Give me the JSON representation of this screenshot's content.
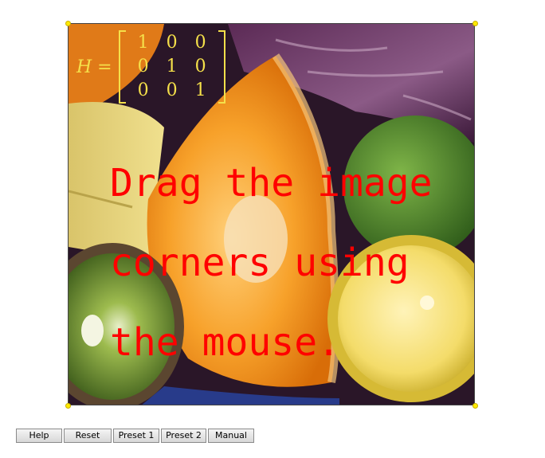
{
  "matrix": {
    "lhs": "H =",
    "rows": [
      [
        "1",
        "0",
        "0"
      ],
      [
        "0",
        "1",
        "0"
      ],
      [
        "0",
        "0",
        "1"
      ]
    ],
    "color": "#f5e04a"
  },
  "instructions": {
    "lines": [
      "Drag the image",
      "corners using",
      "the mouse."
    ],
    "color": "#ff0000"
  },
  "handle_color": "#ffea00",
  "buttons": {
    "help": "Help",
    "reset": "Reset",
    "preset1": "Preset 1",
    "preset2": "Preset 2",
    "manual": "Manual"
  }
}
